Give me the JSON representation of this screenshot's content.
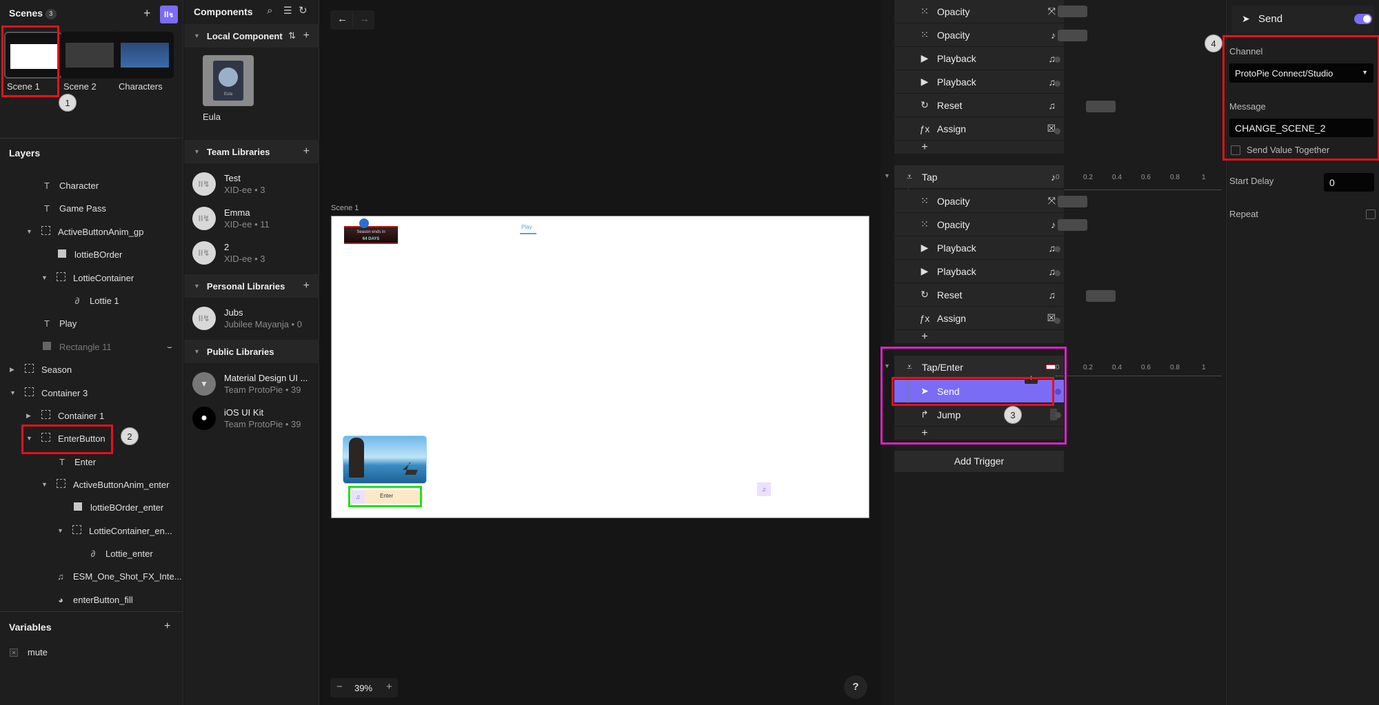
{
  "scenes": {
    "title": "Scenes",
    "count": "3",
    "items": [
      {
        "label": "Scene 1",
        "selected": true
      },
      {
        "label": "Scene 2",
        "selected": false
      },
      {
        "label": "Characters",
        "selected": false
      }
    ]
  },
  "layers": {
    "title": "Layers",
    "items": [
      {
        "label": "Character",
        "icon": "text-icon"
      },
      {
        "label": "Game Pass",
        "icon": "text-icon"
      },
      {
        "label": "ActiveButtonAnim_gp",
        "icon": "container-icon",
        "expanded": true
      },
      {
        "label": "lottieBOrder",
        "icon": "rectangle-icon"
      },
      {
        "label": "LottieContainer",
        "icon": "container-icon",
        "expanded": true
      },
      {
        "label": "Lottie 1",
        "icon": "lottie-icon"
      },
      {
        "label": "Play",
        "icon": "text-icon"
      },
      {
        "label": "Rectangle 11",
        "icon": "image-icon",
        "hidden": true
      },
      {
        "label": "Season",
        "icon": "container-icon",
        "expanded": false
      },
      {
        "label": "Container 3",
        "icon": "container-icon",
        "expanded": true
      },
      {
        "label": "Container 1",
        "icon": "container-icon",
        "expanded": false
      },
      {
        "label": "EnterButton",
        "icon": "container-icon",
        "expanded": true
      },
      {
        "label": "Enter",
        "icon": "text-icon"
      },
      {
        "label": "ActiveButtonAnim_enter",
        "icon": "container-icon",
        "expanded": true
      },
      {
        "label": "lottieBOrder_enter",
        "icon": "rectangle-icon"
      },
      {
        "label": "LottieContainer_en...",
        "icon": "container-icon",
        "expanded": true
      },
      {
        "label": "Lottie_enter",
        "icon": "lottie-icon"
      },
      {
        "label": "ESM_One_Shot_FX_Inte...",
        "icon": "audio-icon"
      },
      {
        "label": "enterButton_fill",
        "icon": "shape-icon"
      }
    ]
  },
  "variables": {
    "title": "Variables",
    "items": [
      {
        "label": "mute"
      }
    ]
  },
  "components": {
    "title": "Components",
    "local": {
      "title": "Local Component",
      "items": [
        {
          "label": "Eula",
          "card_text": "Eula"
        }
      ]
    },
    "team": {
      "title": "Team Libraries",
      "items": [
        {
          "name": "Test",
          "sub": "XID-ee • 3"
        },
        {
          "name": "Emma",
          "sub": "XID-ee • 11"
        },
        {
          "name": "2",
          "sub": "XID-ee • 3"
        }
      ]
    },
    "personal": {
      "title": "Personal Libraries",
      "items": [
        {
          "name": "Jubs",
          "sub": "Jubilee Mayanja • 0"
        }
      ]
    },
    "public": {
      "title": "Public Libraries",
      "items": [
        {
          "name": "Material Design UI ...",
          "sub": "Team ProtoPie • 39"
        },
        {
          "name": "iOS UI Kit",
          "sub": "Team ProtoPie • 39"
        }
      ]
    }
  },
  "canvas": {
    "scene_label": "Scene 1",
    "zoom": "39%",
    "banner_line1": "Season ends in",
    "banner_line2": "64 DAYS",
    "play_text": "Play",
    "enter_text": "Enter",
    "help": "?"
  },
  "interactions": {
    "group1_responses": [
      {
        "label": "Opacity",
        "icon": "opacity-icon",
        "target": "lottie-icon"
      },
      {
        "label": "Opacity",
        "icon": "opacity-icon",
        "target": "note-icon"
      },
      {
        "label": "Playback",
        "icon": "play-icon",
        "target": "music-icon"
      },
      {
        "label": "Playback",
        "icon": "play-icon",
        "target": "music-icon"
      },
      {
        "label": "Reset",
        "icon": "reset-icon",
        "target": "music-icon"
      },
      {
        "label": "Assign",
        "icon": "formula-icon",
        "target": "variable-icon"
      }
    ],
    "trigger_tap": {
      "label": "Tap",
      "responses": [
        {
          "label": "Opacity",
          "icon": "opacity-icon",
          "target": "lottie-icon"
        },
        {
          "label": "Opacity",
          "icon": "opacity-icon",
          "target": "note-icon"
        },
        {
          "label": "Playback",
          "icon": "play-icon",
          "target": "music-icon"
        },
        {
          "label": "Playback",
          "icon": "play-icon",
          "target": "music-icon"
        },
        {
          "label": "Reset",
          "icon": "reset-icon",
          "target": "music-icon"
        },
        {
          "label": "Assign",
          "icon": "formula-icon",
          "target": "variable-icon"
        }
      ]
    },
    "trigger_tap_enter": {
      "label": "Tap/Enter",
      "responses": [
        {
          "label": "Send",
          "icon": "send-icon",
          "selected": true
        },
        {
          "label": "Jump",
          "icon": "jump-icon"
        }
      ]
    },
    "ruler_ticks": [
      "0",
      "0.2",
      "0.4",
      "0.6",
      "0.8",
      "1"
    ],
    "add_trigger": "Add Trigger"
  },
  "properties": {
    "response_title": "Send",
    "enabled": true,
    "channel_label": "Channel",
    "channel_value": "ProtoPie Connect/Studio",
    "message_label": "Message",
    "message_value": "CHANGE_SCENE_2",
    "send_value_label": "Send Value Together",
    "send_value_checked": false,
    "start_delay_label": "Start Delay",
    "start_delay_value": "0",
    "repeat_label": "Repeat",
    "repeat_checked": false
  },
  "annotations": {
    "callouts": [
      "1",
      "2",
      "3",
      "4"
    ],
    "colors": {
      "red": "#e8101a",
      "magenta": "#e020c8",
      "green": "#22e01a",
      "accent": "#7b6cf6"
    }
  }
}
